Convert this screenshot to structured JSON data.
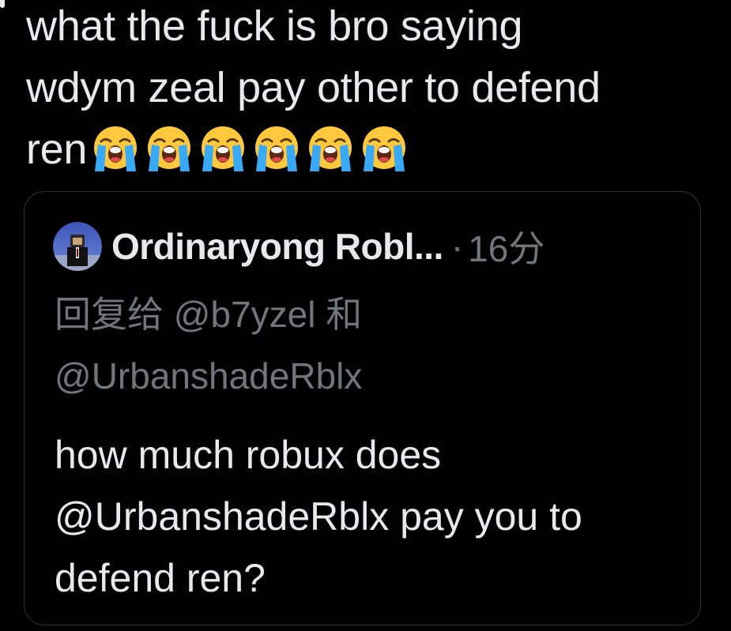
{
  "tweet": {
    "lines": [
      "what the fuck is bro saying",
      "wdym zeal pay other to defend",
      "ren"
    ],
    "emoji_count": 6,
    "emoji_name": "loudly-crying-face"
  },
  "quote": {
    "author_name": "Ordinaryong Robl...",
    "separator": "·",
    "timestamp": "16分",
    "reply_to_lines": [
      "回复给 @b7yzel 和",
      "@UrbanshadeRblx"
    ],
    "body_lines": [
      "how much robux does",
      "@UrbanshadeRblx pay you to",
      "defend ren?"
    ]
  },
  "colors": {
    "background": "#000000",
    "text_primary": "#e7e9ea",
    "text_secondary": "#71767b",
    "card_border": "#2f3336",
    "emoji_face": "#ffc83d",
    "emoji_tears": "#3aa9f5"
  }
}
